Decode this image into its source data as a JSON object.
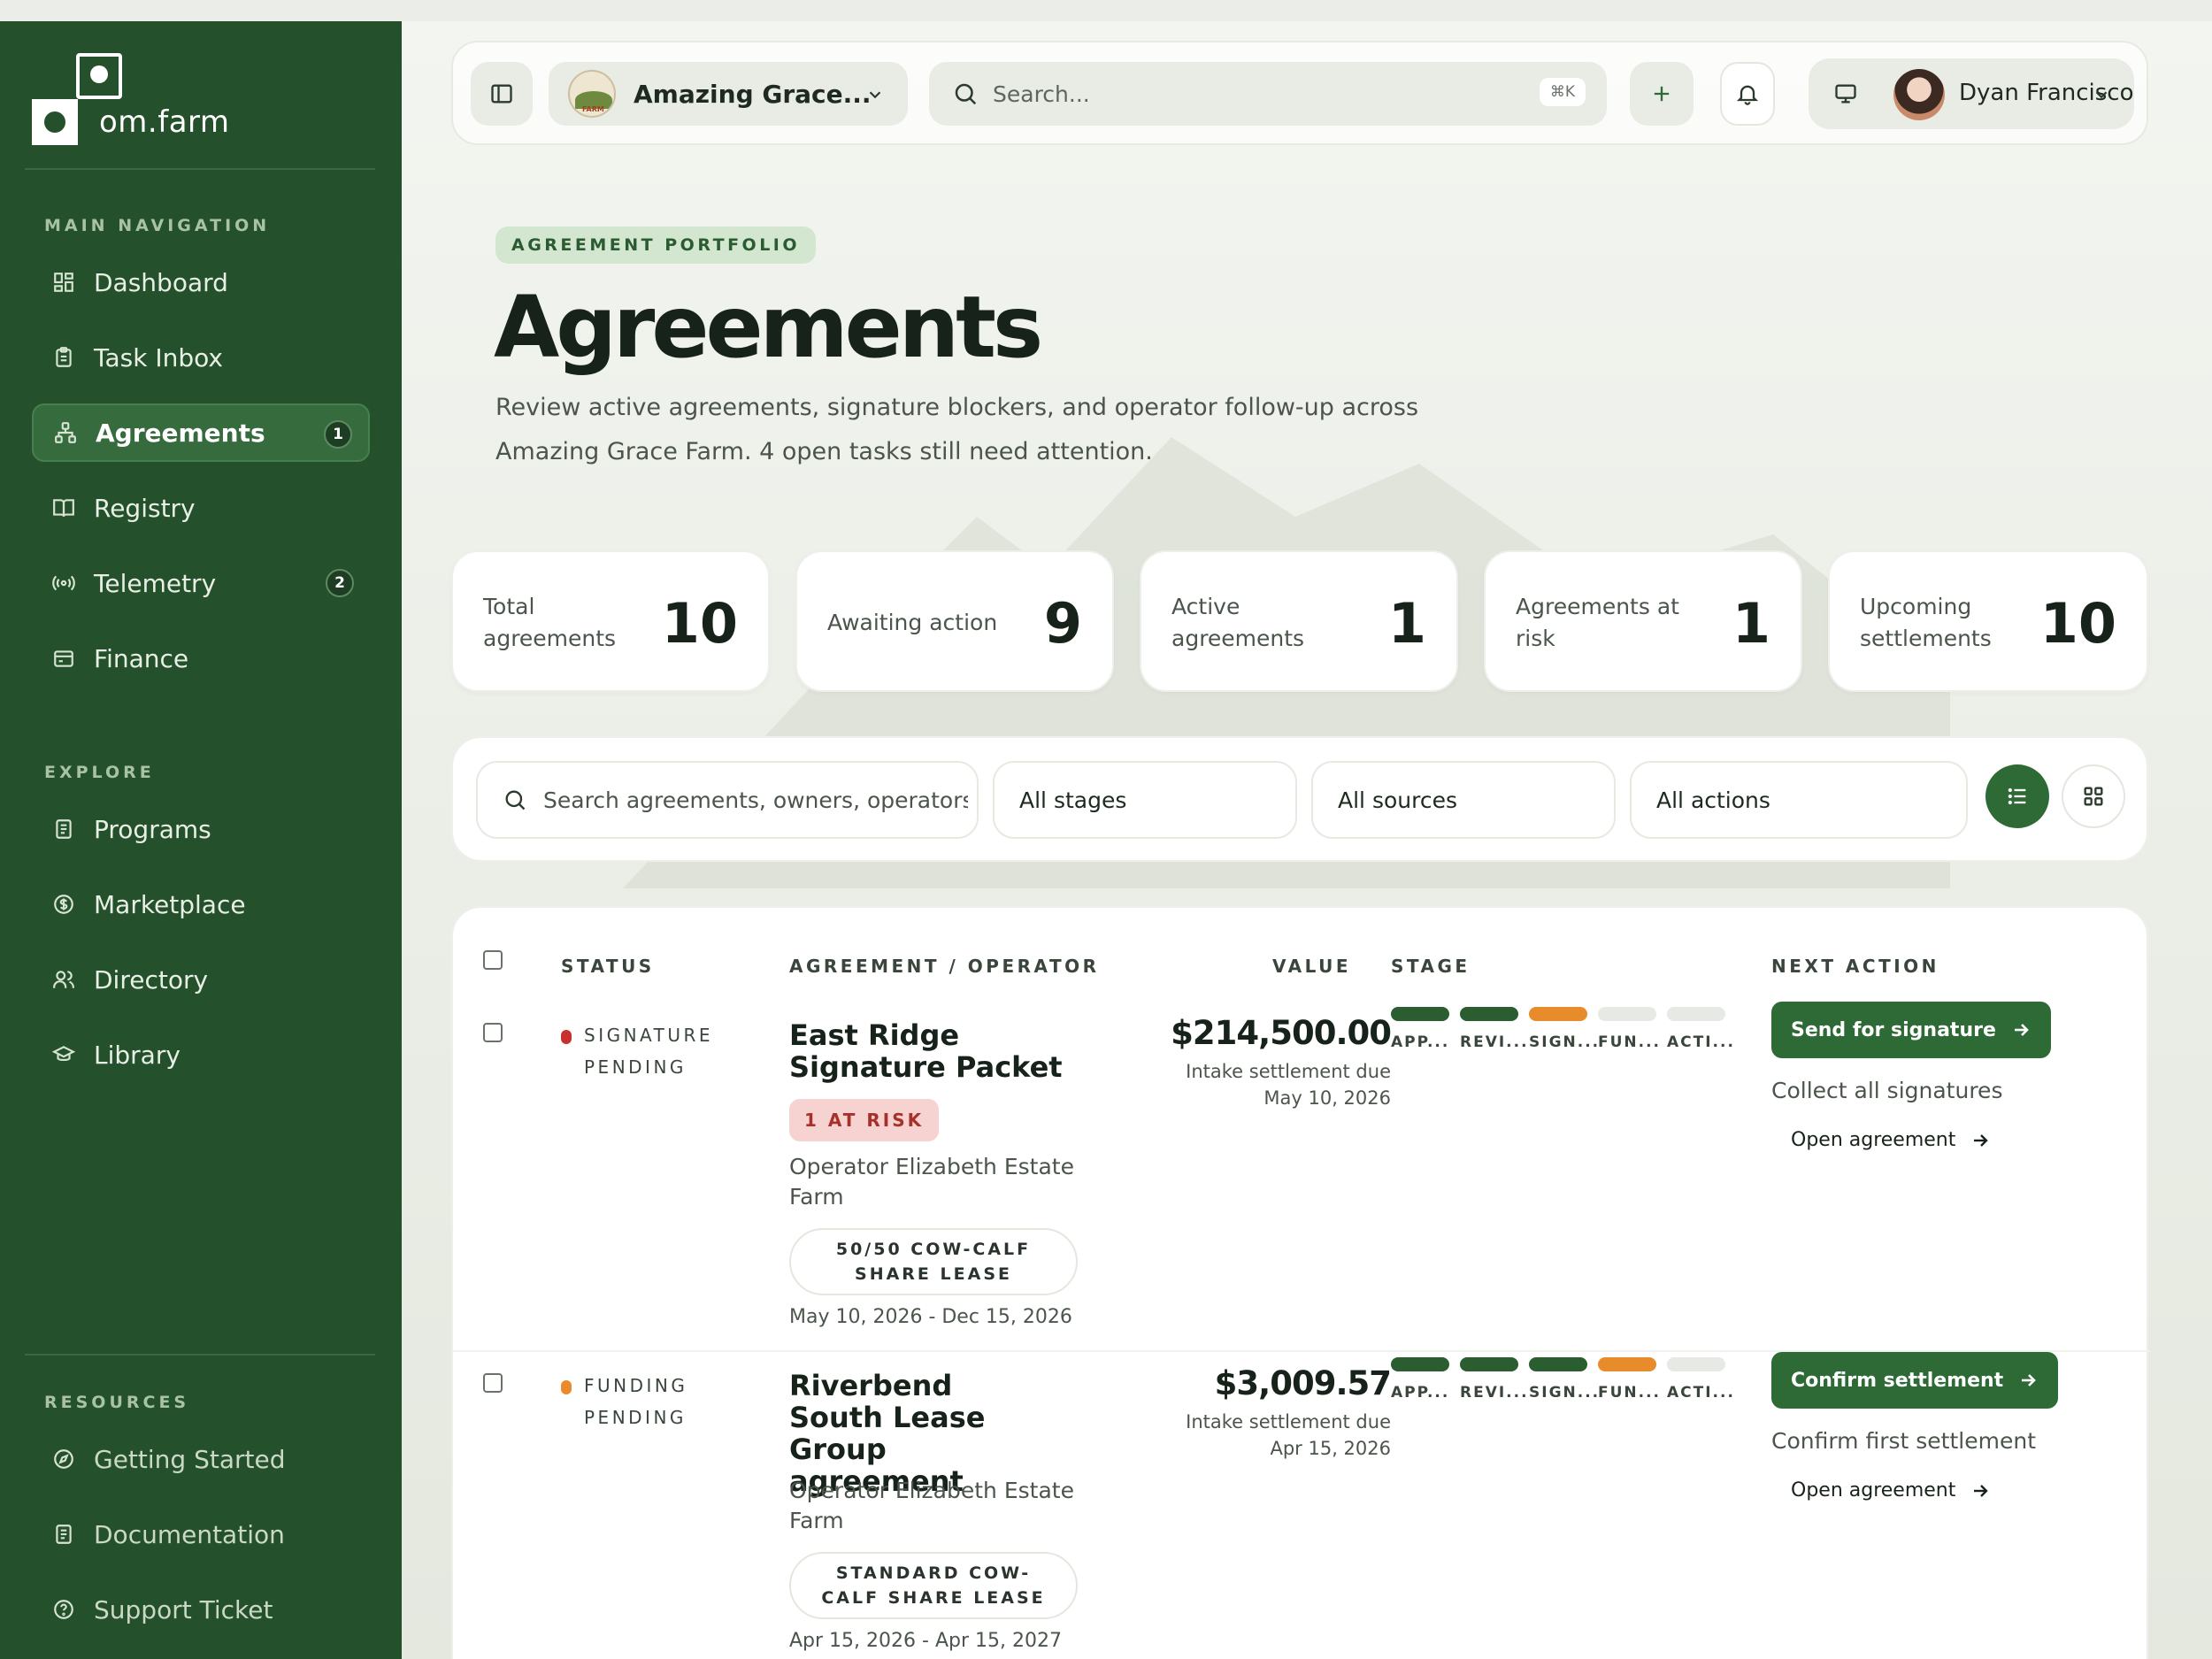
{
  "app": {
    "brand": "om.farm",
    "farm_name": "Amazing Grace...",
    "farm_logo_text": "FARM",
    "search_placeholder": "Search...",
    "search_shortcut": "⌘K",
    "user_name": "Dyan Francisco"
  },
  "sidebar": {
    "main_label": "MAIN NAVIGATION",
    "main_items": [
      {
        "label": "Dashboard",
        "icon": "dashboard-icon"
      },
      {
        "label": "Task Inbox",
        "icon": "clipboard-icon"
      },
      {
        "label": "Agreements",
        "icon": "network-icon",
        "badge": "1",
        "active": true
      },
      {
        "label": "Registry",
        "icon": "book-icon"
      },
      {
        "label": "Telemetry",
        "icon": "signal-icon",
        "badge": "2"
      },
      {
        "label": "Finance",
        "icon": "wallet-icon"
      }
    ],
    "explore_label": "EXPLORE",
    "explore_items": [
      {
        "label": "Programs",
        "icon": "document-icon"
      },
      {
        "label": "Marketplace",
        "icon": "dollar-icon"
      },
      {
        "label": "Directory",
        "icon": "users-icon"
      },
      {
        "label": "Library",
        "icon": "graduation-cap-icon"
      }
    ],
    "resources_label": "RESOURCES",
    "resource_items": [
      {
        "label": "Getting Started",
        "icon": "compass-icon"
      },
      {
        "label": "Documentation",
        "icon": "document-icon"
      },
      {
        "label": "Support Ticket",
        "icon": "help-circle-icon"
      }
    ]
  },
  "header": {
    "eyebrow": "AGREEMENT PORTFOLIO",
    "title": "Agreements",
    "description": "Review active agreements, signature blockers, and operator follow-up across Amazing Grace Farm. 4 open tasks still need attention."
  },
  "stats": [
    {
      "label": "Total agreements",
      "value": "10"
    },
    {
      "label": "Awaiting action",
      "value": "9"
    },
    {
      "label": "Active agreements",
      "value": "1"
    },
    {
      "label": "Agreements at risk",
      "value": "1"
    },
    {
      "label": "Upcoming settlements",
      "value": "10"
    }
  ],
  "filters": {
    "search_placeholder": "Search agreements, owners, operators, o",
    "stage": "All stages",
    "source": "All sources",
    "action": "All actions"
  },
  "table": {
    "headers": {
      "status": "STATUS",
      "agreement": "AGREEMENT / OPERATOR",
      "value": "VALUE",
      "stage": "STAGE",
      "next_action": "NEXT ACTION"
    },
    "stage_labels": [
      "APP...",
      "REVI...",
      "SIGN...",
      "FUN...",
      "ACTI..."
    ],
    "colors": {
      "done": "#2a5d2f",
      "current": "#e88b2a",
      "todo": "#e7e9e4",
      "risk_dot": "#c8302c",
      "funding_dot": "#e88b2a"
    },
    "rows": [
      {
        "status_line1": "SIGNATURE",
        "status_line2": "PENDING",
        "title": "East Ridge Signature Packet",
        "risk": "1 AT RISK",
        "operator": "Operator Elizabeth Estate Farm",
        "lease": "50/50 COW-CALF SHARE LEASE",
        "dates": "May 10, 2026 - Dec 15, 2026",
        "amount": "$214,500.00",
        "due_line1": "Intake settlement due",
        "due_line2": "May 10, 2026",
        "stages": [
          "done",
          "done",
          "current",
          "todo",
          "todo"
        ],
        "action_label": "Send for signature",
        "action_sub": "Collect all signatures",
        "open_label": "Open agreement"
      },
      {
        "status_line1": "FUNDING",
        "status_line2": "PENDING",
        "title": "Riverbend South Lease Group agreement",
        "operator": "Operator Elizabeth Estate Farm",
        "lease": "STANDARD COW-CALF SHARE LEASE",
        "dates": "Apr 15, 2026 - Apr 15, 2027",
        "amount": "$3,009.57",
        "due_line1": "Intake settlement due",
        "due_line2": "Apr 15, 2026",
        "stages": [
          "done",
          "done",
          "done",
          "current",
          "todo"
        ],
        "action_label": "Confirm settlement",
        "action_sub": "Confirm first settlement",
        "open_label": "Open agreement"
      }
    ]
  }
}
